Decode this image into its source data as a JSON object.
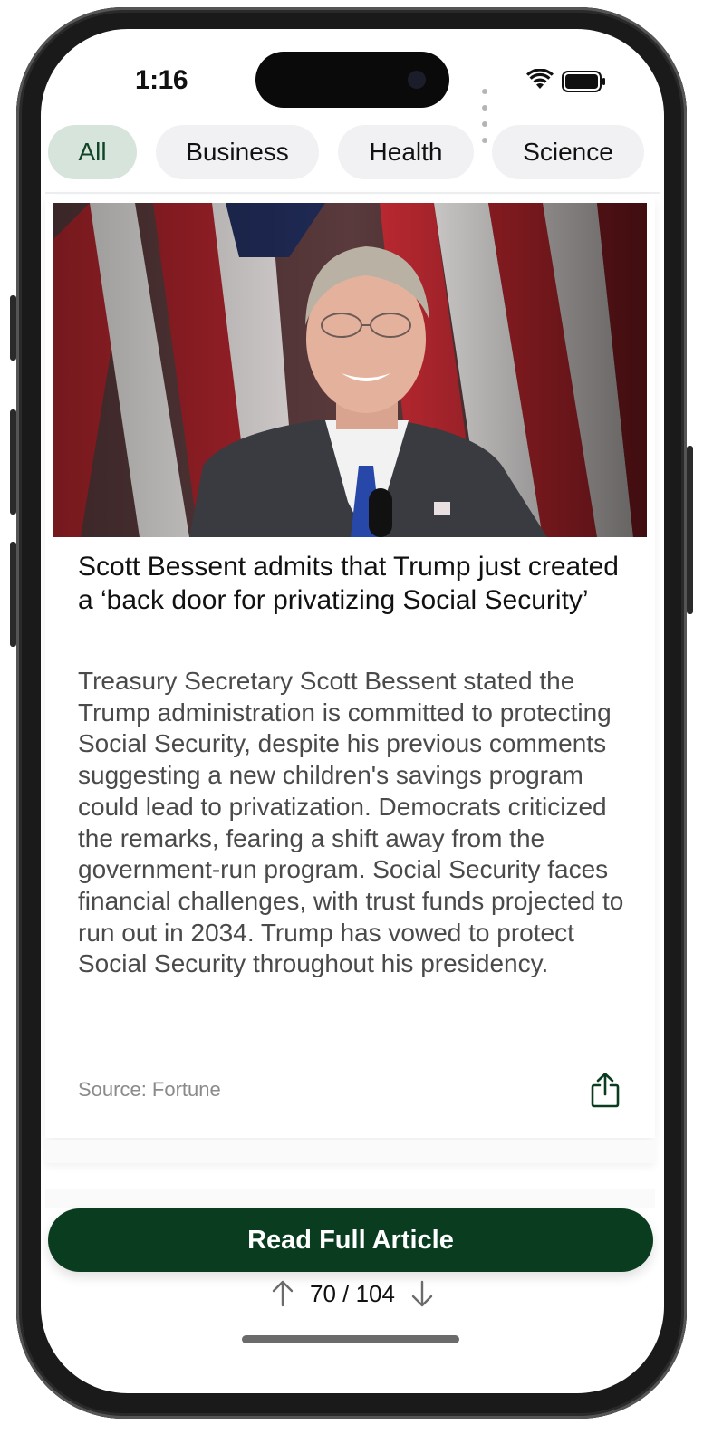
{
  "status_bar": {
    "time": "1:16"
  },
  "tabs": [
    {
      "label": "All",
      "active": true
    },
    {
      "label": "Business",
      "active": false
    },
    {
      "label": "Health",
      "active": false
    },
    {
      "label": "Science",
      "active": false
    }
  ],
  "article": {
    "headline": "Scott Bessent admits that Trump just created a ‘back door for privatizing Social Security’",
    "summary": "Treasury Secretary Scott Bessent stated the Trump administration is committed to protecting Social Security, despite his previous comments suggesting a new children's savings program could lead to privatization. Democrats criticized the remarks, fearing a shift away from the government-run program. Social Security faces financial challenges, with trust funds projected to run out in 2034. Trump has vowed to protect Social Security throughout his presidency.",
    "source": "Source: Fortune",
    "share_icon": "share-icon"
  },
  "actions": {
    "read_full_label": "Read Full Article"
  },
  "pager": {
    "text": "70 / 104",
    "current": 70,
    "total": 104
  },
  "colors": {
    "accent": "#0a3d20",
    "active_tab_bg": "#d7e4dc",
    "tab_bg": "#f1f1f3"
  }
}
